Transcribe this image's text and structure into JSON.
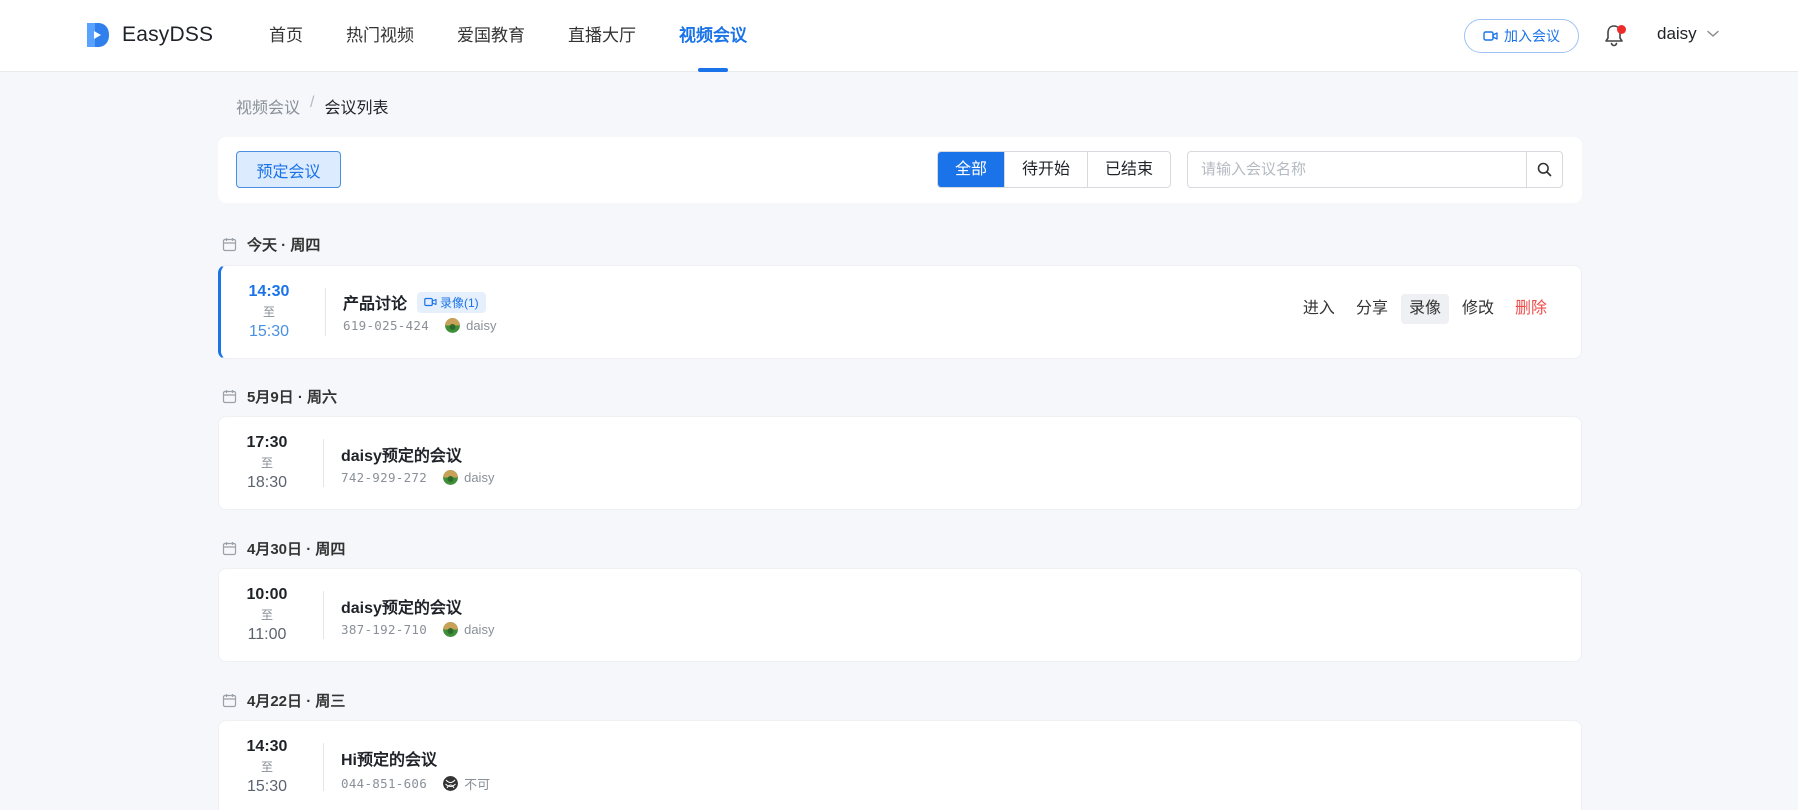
{
  "header": {
    "logo_text": "EasyDSS",
    "nav": [
      {
        "label": "首页",
        "active": false
      },
      {
        "label": "热门视频",
        "active": false
      },
      {
        "label": "爱国教育",
        "active": false
      },
      {
        "label": "直播大厅",
        "active": false
      },
      {
        "label": "视频会议",
        "active": true
      }
    ],
    "join_button": "加入会议",
    "user_name": "daisy"
  },
  "breadcrumb": {
    "parent": "视频会议",
    "separator": "/",
    "current": "会议列表"
  },
  "toolbar": {
    "schedule_button": "预定会议",
    "filters": [
      "全部",
      "待开始",
      "已结束"
    ],
    "active_filter": "全部",
    "search_placeholder": "请输入会议名称",
    "search_value": ""
  },
  "groups": [
    {
      "date": "今天 · 周四",
      "meetings": [
        {
          "start": "14:30",
          "to": "至",
          "end": "15:30",
          "title": "产品讨论",
          "badge": "录像(1)",
          "id": "619-025-424",
          "host": "daisy",
          "actions": [
            "进入",
            "分享",
            "录像",
            "修改",
            "删除"
          ]
        }
      ]
    },
    {
      "date": "5月9日 · 周六",
      "meetings": [
        {
          "start": "17:30",
          "to": "至",
          "end": "18:30",
          "title": "daisy预定的会议",
          "id": "742-929-272",
          "host": "daisy"
        }
      ]
    },
    {
      "date": "4月30日 · 周四",
      "meetings": [
        {
          "start": "10:00",
          "to": "至",
          "end": "11:00",
          "title": "daisy预定的会议",
          "id": "387-192-710",
          "host": "daisy"
        }
      ]
    },
    {
      "date": "4月22日 · 周三",
      "meetings": [
        {
          "start": "14:30",
          "to": "至",
          "end": "15:30",
          "title": "Hi预定的会议",
          "id": "044-851-606",
          "host": "不可"
        }
      ]
    }
  ],
  "colors": {
    "accent": "#1a73e8",
    "danger": "#f04b4b",
    "notification_dot": "#ee2b2b"
  }
}
